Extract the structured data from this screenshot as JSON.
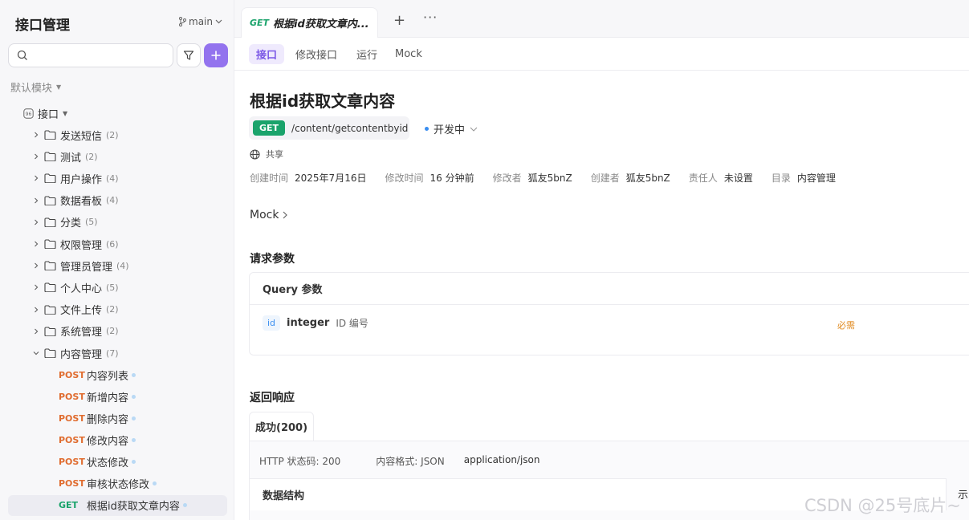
{
  "sidebar": {
    "title": "接口管理",
    "branch": "main",
    "module": "默认模块",
    "root_label": "接口",
    "folders": [
      {
        "name": "发送短信",
        "count": "(2)"
      },
      {
        "name": "测试",
        "count": "(2)"
      },
      {
        "name": "用户操作",
        "count": "(4)"
      },
      {
        "name": "数据看板",
        "count": "(4)"
      },
      {
        "name": "分类",
        "count": "(5)"
      },
      {
        "name": "权限管理",
        "count": "(6)"
      },
      {
        "name": "管理员管理",
        "count": "(4)"
      },
      {
        "name": "个人中心",
        "count": "(5)"
      },
      {
        "name": "文件上传",
        "count": "(2)"
      },
      {
        "name": "系统管理",
        "count": "(2)"
      },
      {
        "name": "内容管理",
        "count": "(7)"
      }
    ],
    "endpoints": [
      {
        "method": "POST",
        "name": "内容列表"
      },
      {
        "method": "POST",
        "name": "新增内容"
      },
      {
        "method": "POST",
        "name": "删除内容"
      },
      {
        "method": "POST",
        "name": "修改内容"
      },
      {
        "method": "POST",
        "name": "状态修改"
      },
      {
        "method": "POST",
        "name": "审核状态修改"
      },
      {
        "method": "GET",
        "name": "根据id获取文章内容"
      }
    ]
  },
  "tabs": {
    "active_method": "GET",
    "active_title": "根据id获取文章内...",
    "plus": "+",
    "more": "···"
  },
  "subtabs": [
    "接口",
    "修改接口",
    "运行",
    "Mock"
  ],
  "main": {
    "title": "根据id获取文章内容",
    "method": "GET",
    "url": "/content/getcontentbyid",
    "status": "开发中",
    "share": "共享",
    "meta": [
      {
        "k": "创建时间",
        "v": "2025年7月16日"
      },
      {
        "k": "修改时间",
        "v": "16 分钟前"
      },
      {
        "k": "修改者",
        "v": "狐友5bnZ"
      },
      {
        "k": "创建者",
        "v": "狐友5bnZ"
      },
      {
        "k": "责任人",
        "v": "未设置"
      },
      {
        "k": "目录",
        "v": "内容管理"
      }
    ],
    "mock": "Mock",
    "request_title": "请求参数",
    "query_title": "Query 参数",
    "param": {
      "name": "id",
      "type": "integer",
      "desc": "ID 编号",
      "required": "必需"
    },
    "response_title": "返回响应",
    "response_tab": "成功(200)",
    "http_status": "HTTP 状态码: 200",
    "format": "内容格式: JSON",
    "content_type": "application/json",
    "data_structure": "数据结构",
    "example": "示"
  },
  "watermark": "CSDN @25号底片~",
  "colors": {
    "accent": "#9373ee",
    "get": "#1aa36b",
    "post": "#e06c2f"
  }
}
